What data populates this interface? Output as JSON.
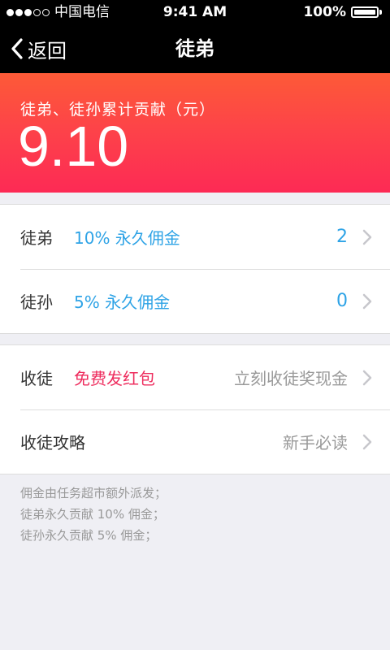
{
  "status_bar": {
    "carrier": "中国电信",
    "time": "9:41 AM",
    "battery": "100%",
    "battery_level": 1.0,
    "signal_bars_filled": 3,
    "signal_bars_total": 5
  },
  "nav": {
    "back_label": "返回",
    "title": "徒弟"
  },
  "hero": {
    "label": "徒弟、徒孙累计贡献（元）",
    "value": "9.10",
    "colors": [
      "#fd5a37",
      "#fd2a55"
    ]
  },
  "disciples": [
    {
      "title": "徒弟",
      "subtitle": "10% 永久佣金",
      "count": "2"
    },
    {
      "title": "徒孙",
      "subtitle": "5% 永久佣金",
      "count": "0"
    }
  ],
  "recruit": {
    "title": "收徒",
    "subtitle": "免费发红包",
    "action": "立刻收徒奖现金"
  },
  "guide": {
    "title": "收徒攻略",
    "action": "新手必读"
  },
  "notes": [
    "佣金由任务超市额外派发；",
    "徒弟永久贡献 10% 佣金；",
    "徒孙永久贡献 5% 佣金；"
  ],
  "colors": {
    "accent_blue": "#2ea3e6",
    "accent_red": "#ee2d5e",
    "background": "#efeff4"
  }
}
